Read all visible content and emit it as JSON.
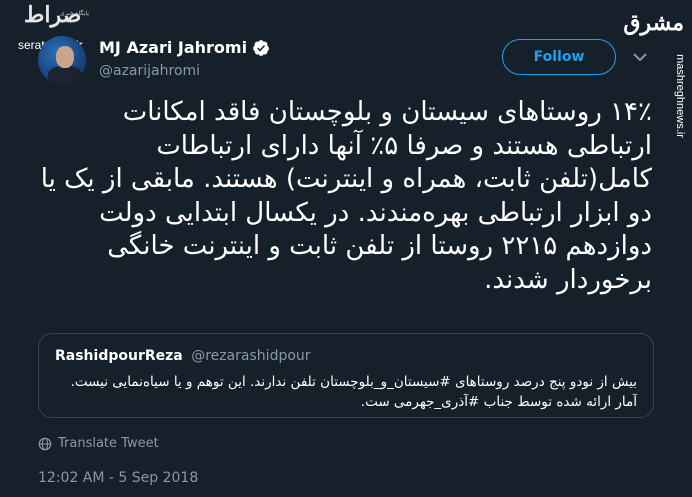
{
  "watermark": {
    "left_logo": "صراط",
    "left_subtitle": "پایگاه خبری تحلیلی",
    "left_url": "seratnews.ir",
    "right_logo": "مشرق",
    "right_url": "mashreghnews.ir"
  },
  "author": {
    "name": "MJ Azari Jahromi",
    "handle": "@azarijahromi",
    "verified_icon": "verified-badge-icon"
  },
  "follow_label": "Follow",
  "tweet_text": "۱۴٪ روستاهای سیستان و بلوچستان فاقد امکانات ارتباطی هستند و صرفا ۵٪ آنها دارای ارتباطات کامل(تلفن ثابت، همراه و اینترنت) هستند. مابقی از یک یا دو ابزار ارتباطی بهره‌مندند. در یکسال ابتدایی دولت دوازدهم ۲۲۱۵ روستا از تلفن ثابت و اینترنت خانگی برخوردار شدند.",
  "quote": {
    "name": "RashidpourReza",
    "handle": "@rezarashidpour",
    "text": "بیش از نودو پنج درصد روستاهای #سیستان_و_بلوچستان تلفن ندارند. این توهم و یا سیاه‌نمایی نیست. آمار ارائه شده توسط جناب #آذری_جهرمی ست."
  },
  "translate_label": "Translate Tweet",
  "timestamp": "12:02 AM - 5 Sep 2018",
  "colors": {
    "background": "#15202b",
    "accent": "#1da1f2",
    "muted": "#8899a6",
    "border": "#38444d"
  }
}
